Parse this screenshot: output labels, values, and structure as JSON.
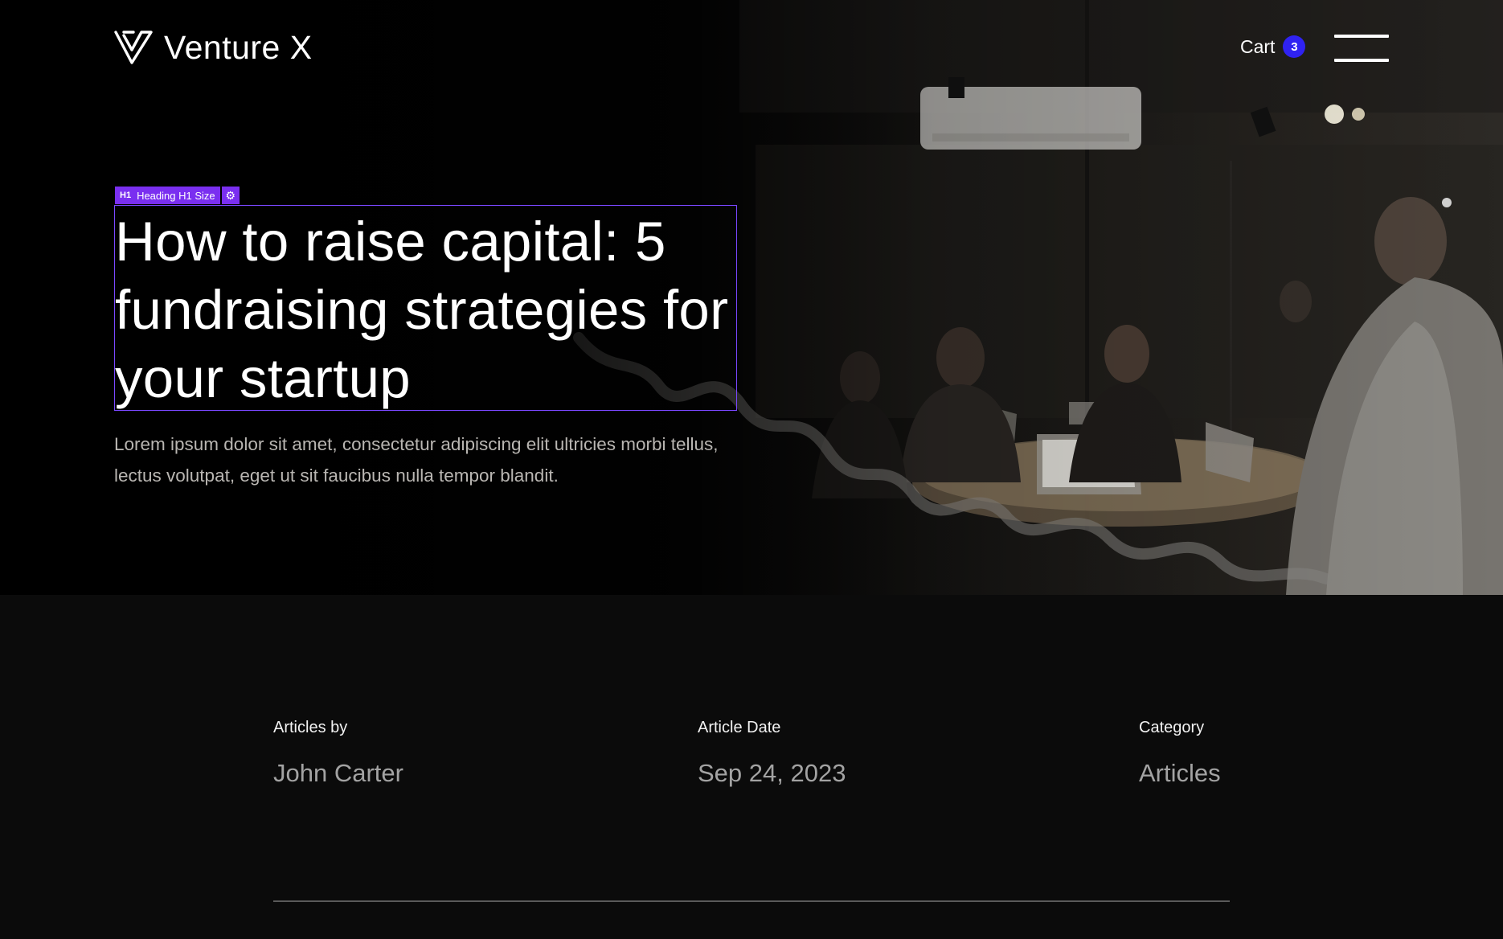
{
  "header": {
    "logo_text": "Venture X",
    "logo_icon": "venture-x-logo-mark",
    "cart_label": "Cart",
    "cart_count": "3",
    "menu_icon": "hamburger-menu-icon"
  },
  "editor": {
    "tag_prefix": "H1",
    "tag_label": "Heading H1 Size",
    "gear_icon": "gear-icon",
    "selection_color": "#7a47ff"
  },
  "hero": {
    "title": "How to raise capital: 5 fundraising strategies for your startup",
    "description": "Lorem ipsum dolor sit amet, consectetur adipiscing elit ultricies morbi tellus, lectus volutpat, eget ut sit faucibus nulla tempor blandit."
  },
  "meta": {
    "author_label": "Articles by",
    "author_value": "John Carter",
    "date_label": "Article Date",
    "date_value": "Sep 24, 2023",
    "category_label": "Category",
    "category_value": "Articles"
  },
  "colors": {
    "accent": "#2f22f2",
    "editor_purple": "#7a2ff0",
    "background": "#0b0b0b"
  }
}
